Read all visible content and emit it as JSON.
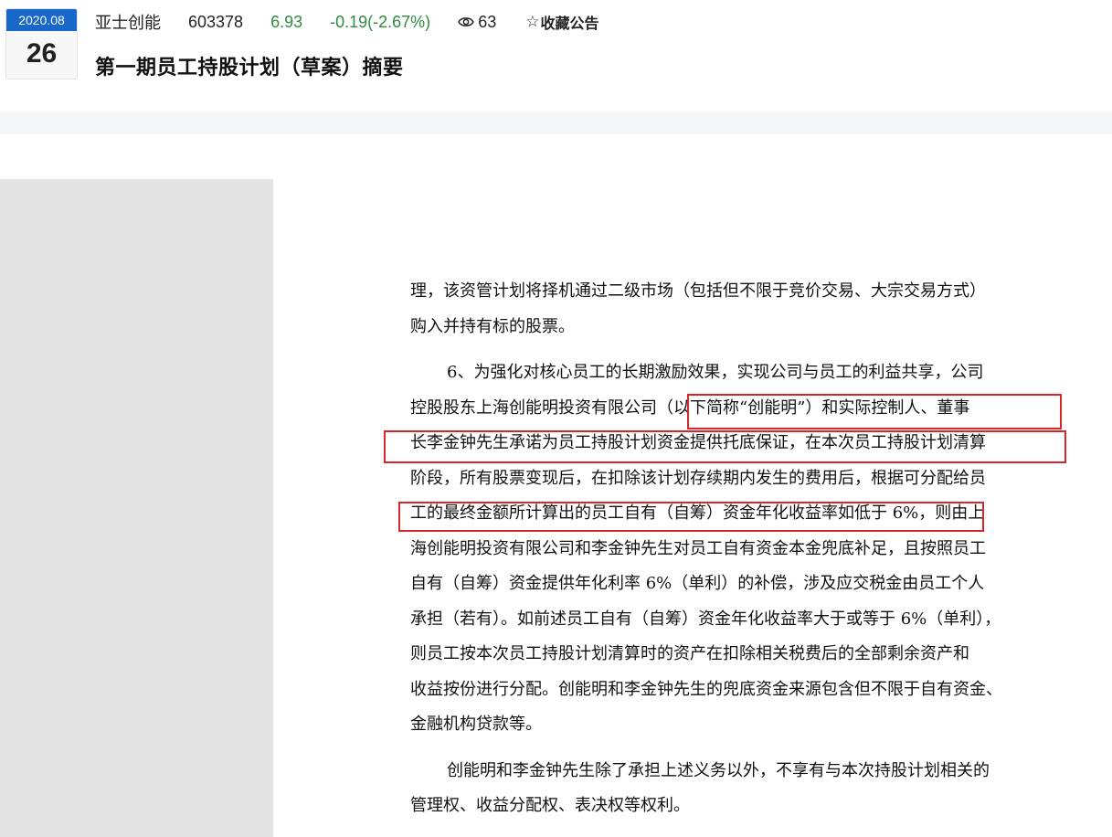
{
  "header": {
    "date_ym": "2020.08",
    "date_day": "26",
    "stock_name": "亚士创能",
    "stock_code": "603378",
    "price": "6.93",
    "change": "-0.19(-2.67%)",
    "views": "63",
    "favorite_label": "收藏公告",
    "title": "第一期员工持股计划（草案）摘要"
  },
  "colors": {
    "date_accent": "#1868c9",
    "price_down": "#2e8b3c",
    "highlight_box": "#d9262a"
  },
  "icons": {
    "views": "eye-icon",
    "favorite": "star-outline-icon"
  },
  "document": {
    "lines": [
      "理，该资管计划将择机通过二级市场（包括但不限于竞价交易、大宗交易方式）",
      "购入并持有标的股票。",
      "6、为强化对核心员工的长期激励效果，实现公司与员工的利益共享，公司",
      "控股股东上海创能明投资有限公司（以下简称“创能明”）和实际控制人、董事",
      "长李金钟先生承诺为员工持股计划资金提供托底保证，在本次员工持股计划清算",
      "阶段，所有股票变现后，在扣除该计划存续期内发生的费用后，根据可分配给员",
      "工的最终金额所计算出的员工自有（自筹）资金年化收益率如低于 6%，则由上",
      "海创能明投资有限公司和李金钟先生对员工自有资金本金兜底补足，且按照员工",
      "自有（自筹）资金提供年化利率 6%（单利）的补偿，涉及应交税金由员工个人",
      "承担（若有）。如前述员工自有（自筹）资金年化收益率大于或等于 6%（单利），",
      "则员工按本次员工持股计划清算时的资产在扣除相关税费后的全部剩余资产和",
      "收益按份进行分配。创能明和李金钟先生的兜底资金来源包含但不限于自有资金、",
      "金融机构贷款等。",
      "创能明和李金钟先生除了承担上述义务以外，不享有与本次持股计划相关的",
      "管理权、收益分配权、表决权等权利。"
    ]
  }
}
